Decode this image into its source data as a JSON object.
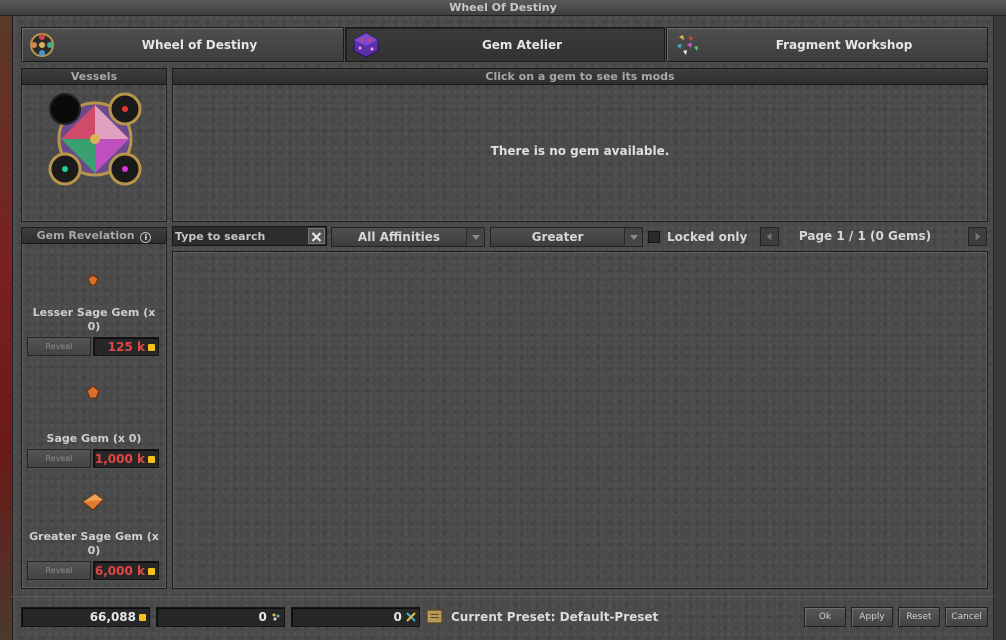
{
  "window": {
    "title": "Wheel Of Destiny"
  },
  "tabs": [
    {
      "label": "Wheel of Destiny",
      "icon": "wheel-icon"
    },
    {
      "label": "Gem Atelier",
      "icon": "gem-die-icon"
    },
    {
      "label": "Fragment Workshop",
      "icon": "fragments-icon"
    }
  ],
  "vessels": {
    "title": "Vessels"
  },
  "mods_panel": {
    "title": "Click on a gem to see its mods",
    "empty_text": "There is no gem available."
  },
  "revelation": {
    "title": "Gem Revelation",
    "reveal_label": "Reveal",
    "gems": [
      {
        "name": "Lesser Sage Gem (x 0)",
        "cost": "125 k"
      },
      {
        "name": "Sage Gem (x 0)",
        "cost": "1,000 k"
      },
      {
        "name": "Greater Sage Gem (x 0)",
        "cost": "6,000 k"
      }
    ]
  },
  "filters": {
    "search_placeholder": "Type to search",
    "affinity": "All Affinities",
    "grade": "Greater",
    "locked_label": "Locked only",
    "page_text": "Page 1 / 1 (0 Gems)"
  },
  "footer": {
    "gold": "66,088",
    "lesser_fragments": "0",
    "greater_fragments": "0",
    "preset": "Current Preset: Default-Preset",
    "buttons": {
      "ok": "Ok",
      "apply": "Apply",
      "reset": "Reset",
      "cancel": "Cancel"
    }
  },
  "colors": {
    "cost_red": "#e34545",
    "gold": "#f4c21a"
  }
}
